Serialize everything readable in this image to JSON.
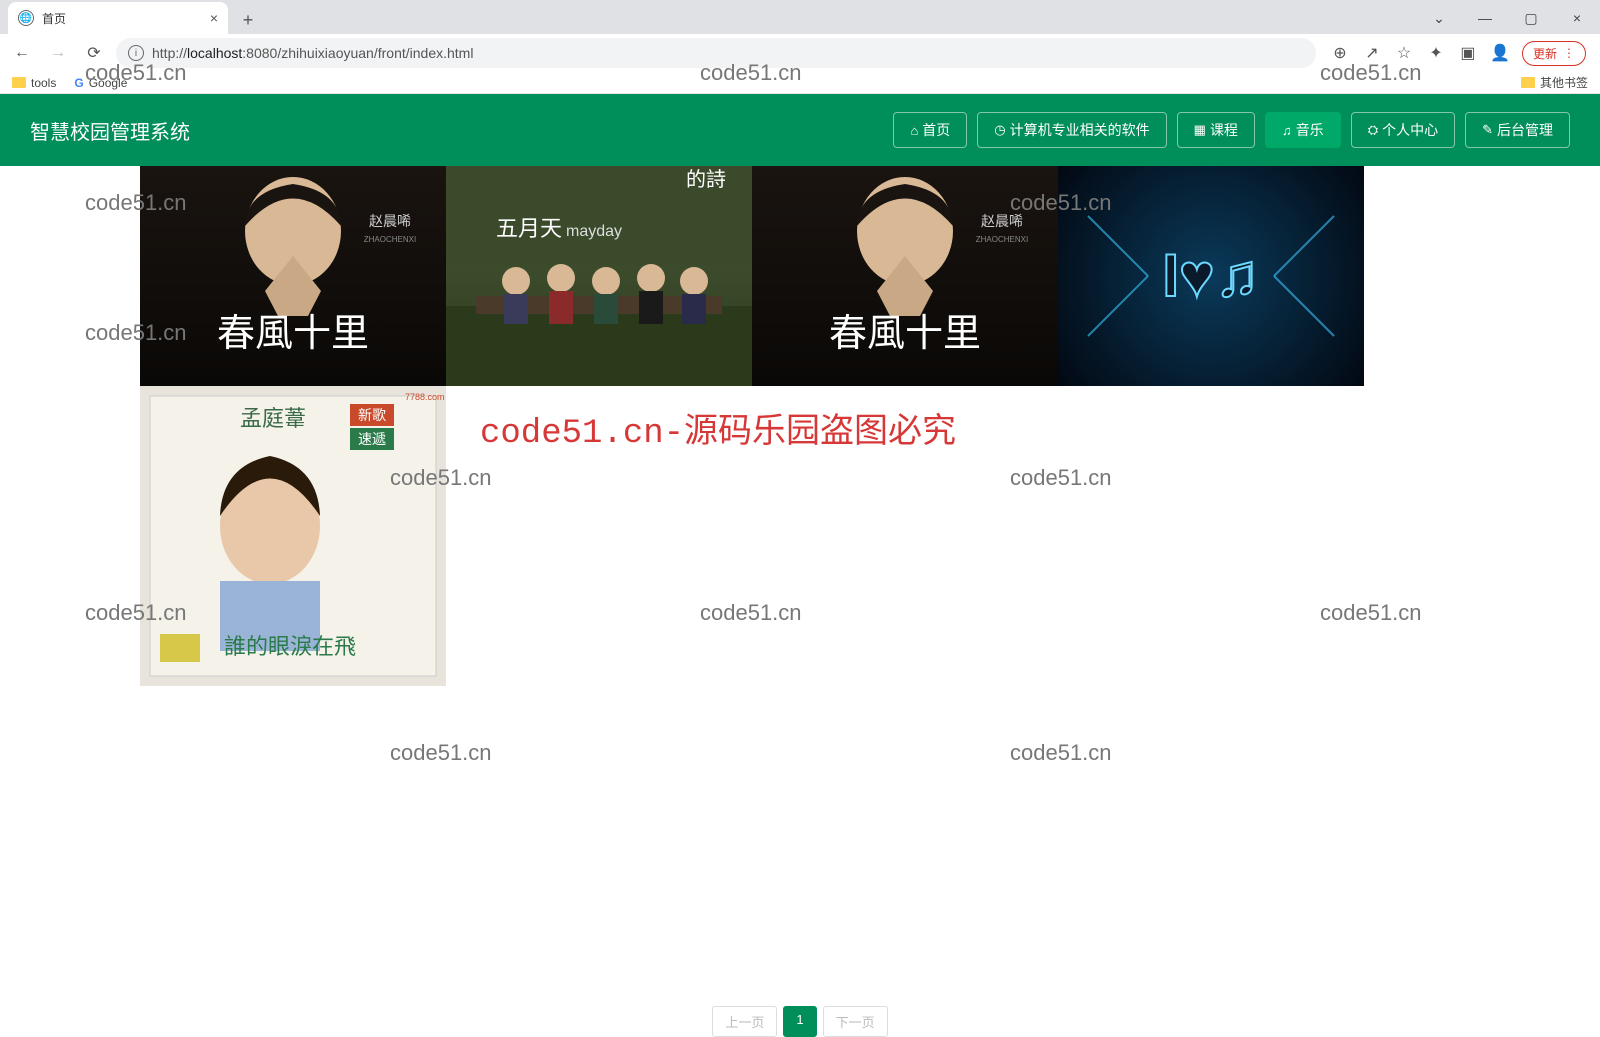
{
  "browser": {
    "tab_title": "首页",
    "new_tab": "+",
    "close": "×",
    "win_min": "—",
    "win_max": "▢",
    "win_close": "×",
    "win_chevron": "⌄",
    "back": "←",
    "forward": "→",
    "reload": "⟳",
    "info": "i",
    "url_prefix": "http://",
    "url_host": "localhost",
    "url_path": ":8080/zhihuixiaoyuan/front/index.html",
    "zoom": "⊕",
    "share": "↗",
    "star": "☆",
    "ext": "✦",
    "panel": "▣",
    "profile": "👤",
    "update": "更新",
    "menu": "⋮",
    "bm_tools": "tools",
    "bm_google": "Google",
    "bm_other": "其他书签"
  },
  "header": {
    "title": "智慧校园管理系统",
    "nav": [
      {
        "icon": "⌂",
        "label": "首页"
      },
      {
        "icon": "◷",
        "label": "计算机专业相关的软件"
      },
      {
        "icon": "▦",
        "label": "课程"
      },
      {
        "icon": "♫",
        "label": "音乐"
      },
      {
        "icon": "⛭",
        "label": "个人中心"
      },
      {
        "icon": "✎",
        "label": "后台管理"
      }
    ]
  },
  "albums": {
    "a1_artist": "赵晨唏",
    "a1_artist_en": "ZHAOCHENXI",
    "a1_title": "春風十里",
    "a2_band": "五月天",
    "a2_band_en": "mayday",
    "a2_top": "的詩",
    "a3_glyph": "I♥♫",
    "a5_name": "孟庭葦",
    "a5_tag1": "新歌",
    "a5_tag2": "速遞",
    "a5_title": "誰的眼淚在飛",
    "a5_corner": "7788.com"
  },
  "watermark": "code51.cn",
  "big_watermark": "code51.cn-源码乐园盗图必究",
  "pagination": {
    "prev": "上一页",
    "current": "1",
    "next": "下一页"
  }
}
